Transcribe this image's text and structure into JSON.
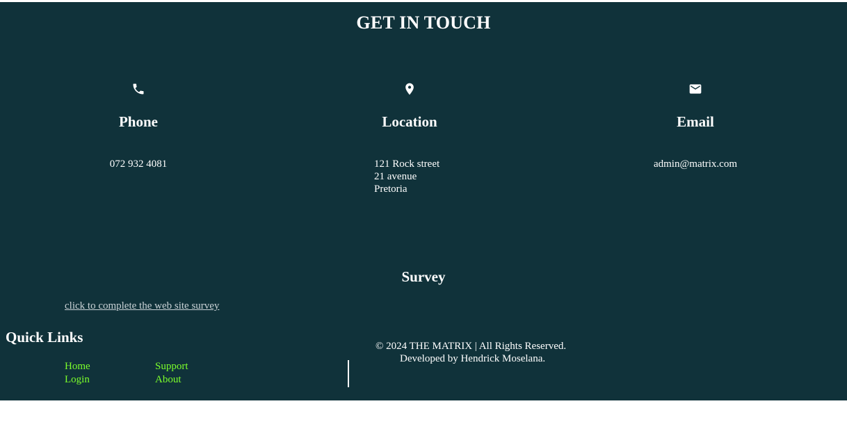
{
  "contact": {
    "title": "GET IN TOUCH",
    "phone": {
      "icon": "phone-icon",
      "heading": "Phone",
      "value": "072 932 4081"
    },
    "location": {
      "icon": "location-pin-icon",
      "heading": "Location",
      "lines": [
        "121 Rock street",
        "21 avenue",
        "Pretoria"
      ]
    },
    "email": {
      "icon": "envelope-icon",
      "heading": "Email",
      "value": "admin@matrix.com"
    }
  },
  "survey": {
    "title": "Survey",
    "link_text": "click to complete the web site survey"
  },
  "quick_links": {
    "title": "Quick Links",
    "items": [
      "Home",
      "Support",
      "Login",
      "About"
    ]
  },
  "footer": {
    "copyright": "© 2024 THE MATRIX | All Rights Reserved.",
    "developed_by": "Developed by Hendrick Moselana."
  },
  "colors": {
    "background": "#10323a",
    "text": "#ffffff",
    "link_green": "#7cff2b",
    "survey_link": "#c9d2d6"
  }
}
